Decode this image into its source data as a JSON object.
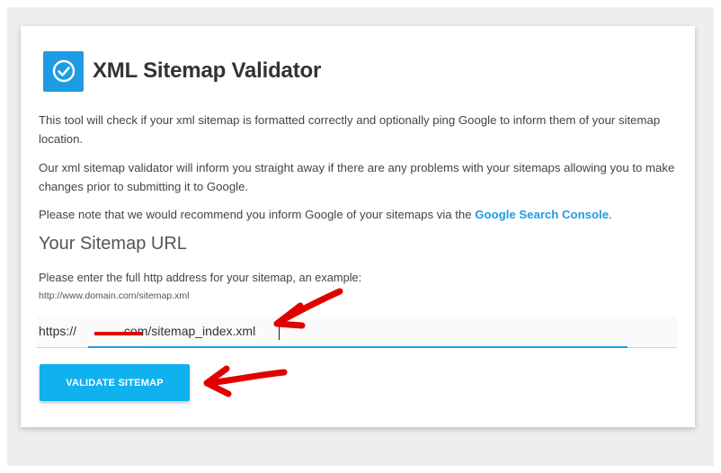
{
  "title": "XML Sitemap Validator",
  "logo_icon": "check-circle-icon",
  "intro_paragraphs": [
    "This tool will check if your xml sitemap is formatted correctly and optionally ping Google to inform them of your sitemap location.",
    "Our xml sitemap validator will inform you straight away if there are any problems with your sitemaps allowing you to make changes prior to submitting it to Google."
  ],
  "note": {
    "text": "Please note that we would recommend you inform Google of your sitemaps via the ",
    "link_text": "Google Search Console",
    "suffix": "."
  },
  "section_heading": "Your Sitemap URL",
  "field": {
    "label": "Please enter the full http address for your sitemap, an example:",
    "example": "http://www.domain.com/sitemap.xml",
    "value": "https://[redacted].com/sitemap_index.xml",
    "visible_prefix": "https://",
    "visible_suffix": ".com/sitemap_index.xml"
  },
  "button": {
    "label": "VALIDATE SITEMAP"
  },
  "colors": {
    "accent": "#1e9ce3",
    "button": "#0fb1ef",
    "annotation": "#e00000"
  }
}
